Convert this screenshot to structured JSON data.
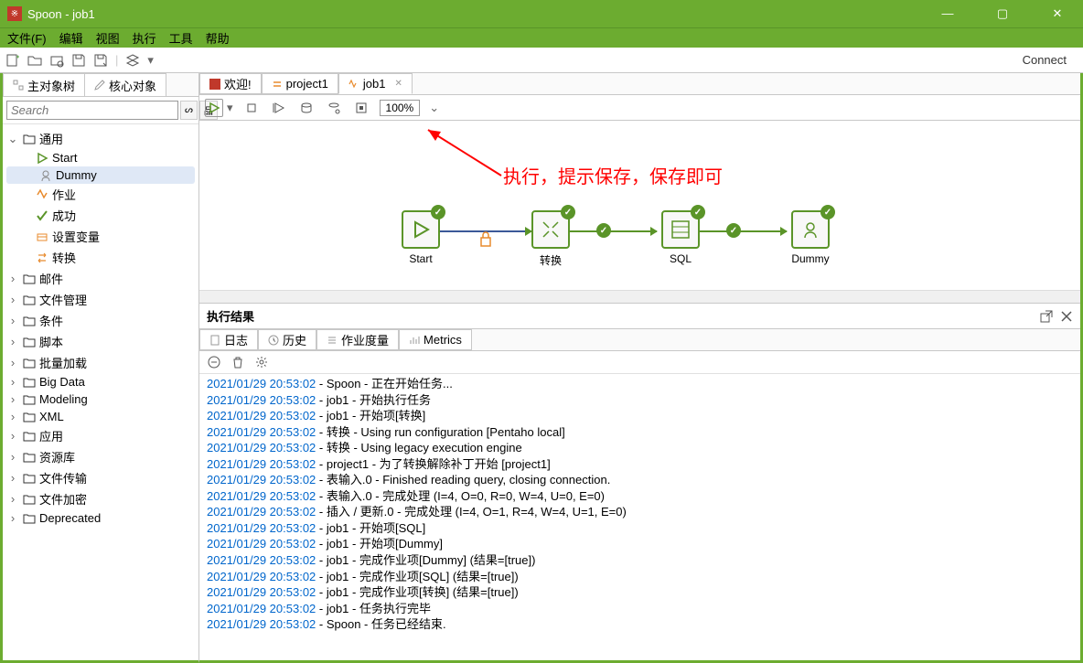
{
  "window": {
    "title": "Spoon - job1"
  },
  "menu": [
    "文件(F)",
    "编辑",
    "视图",
    "执行",
    "工具",
    "帮助"
  ],
  "connect": "Connect",
  "sidebar_tabs": {
    "main": "主对象树",
    "core": "核心对象"
  },
  "search_placeholder": "Search",
  "tree": {
    "general": "通用",
    "items": [
      "Start",
      "Dummy",
      "作业",
      "成功",
      "设置变量",
      "转换"
    ],
    "folders": [
      "邮件",
      "文件管理",
      "条件",
      "脚本",
      "批量加载",
      "Big Data",
      "Modeling",
      "XML",
      "应用",
      "资源库",
      "文件传输",
      "文件加密",
      "Deprecated"
    ]
  },
  "editor_tabs": [
    {
      "label": "欢迎!",
      "icon": "spoon"
    },
    {
      "label": "project1",
      "icon": "trans"
    },
    {
      "label": "job1",
      "icon": "job",
      "active": true
    }
  ],
  "zoom": "100%",
  "annotation": "执行，提示保存，保存即可",
  "flow_nodes": [
    "Start",
    "转换",
    "SQL",
    "Dummy"
  ],
  "results_title": "执行结果",
  "results_tabs": [
    "日志",
    "历史",
    "作业度量",
    "Metrics"
  ],
  "log": [
    {
      "ts": "2021/01/29 20:53:02",
      "msg": "Spoon - 正在开始任务..."
    },
    {
      "ts": "2021/01/29 20:53:02",
      "msg": "job1 - 开始执行任务"
    },
    {
      "ts": "2021/01/29 20:53:02",
      "msg": "job1 - 开始项[转换]"
    },
    {
      "ts": "2021/01/29 20:53:02",
      "msg": "转换 - Using run configuration [Pentaho local]"
    },
    {
      "ts": "2021/01/29 20:53:02",
      "msg": "转换 - Using legacy execution engine"
    },
    {
      "ts": "2021/01/29 20:53:02",
      "msg": "project1 - 为了转换解除补丁开始  [project1]"
    },
    {
      "ts": "2021/01/29 20:53:02",
      "msg": "表输入.0 - Finished reading query, closing connection."
    },
    {
      "ts": "2021/01/29 20:53:02",
      "msg": "表输入.0 - 完成处理 (I=4, O=0, R=0, W=4, U=0, E=0)"
    },
    {
      "ts": "2021/01/29 20:53:02",
      "msg": "插入 / 更新.0 - 完成处理 (I=4, O=1, R=4, W=4, U=1, E=0)"
    },
    {
      "ts": "2021/01/29 20:53:02",
      "msg": "job1 - 开始项[SQL]"
    },
    {
      "ts": "2021/01/29 20:53:02",
      "msg": "job1 - 开始项[Dummy]"
    },
    {
      "ts": "2021/01/29 20:53:02",
      "msg": "job1 - 完成作业项[Dummy] (结果=[true])"
    },
    {
      "ts": "2021/01/29 20:53:02",
      "msg": "job1 - 完成作业项[SQL] (结果=[true])"
    },
    {
      "ts": "2021/01/29 20:53:02",
      "msg": "job1 - 完成作业项[转换] (结果=[true])"
    },
    {
      "ts": "2021/01/29 20:53:02",
      "msg": "job1 - 任务执行完毕"
    },
    {
      "ts": "2021/01/29 20:53:02",
      "msg": "Spoon - 任务已经结束."
    }
  ]
}
